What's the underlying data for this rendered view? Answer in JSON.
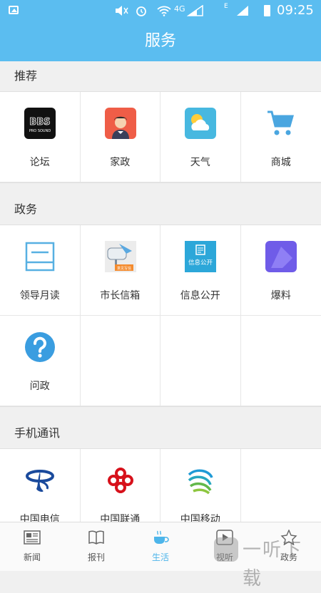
{
  "status_bar": {
    "time": "09:25",
    "network": "4G",
    "network2": "E"
  },
  "header": {
    "title": "服务"
  },
  "sections": [
    {
      "title": "推荐",
      "items": [
        {
          "label": "论坛",
          "icon": "bbs-icon"
        },
        {
          "label": "家政",
          "icon": "housekeeping-icon"
        },
        {
          "label": "天气",
          "icon": "weather-icon"
        },
        {
          "label": "商城",
          "icon": "shopping-cart-icon"
        }
      ]
    },
    {
      "title": "政务",
      "items": [
        {
          "label": "领导月读",
          "icon": "document-icon"
        },
        {
          "label": "市长信箱",
          "icon": "mailbox-icon"
        },
        {
          "label": "信息公开",
          "icon": "info-public-icon"
        },
        {
          "label": "爆料",
          "icon": "tipoff-icon"
        },
        {
          "label": "问政",
          "icon": "question-icon"
        }
      ]
    },
    {
      "title": "手机通讯",
      "items": [
        {
          "label": "中国电信",
          "icon": "china-telecom-icon"
        },
        {
          "label": "中国联通",
          "icon": "china-unicom-icon"
        },
        {
          "label": "中国移动",
          "icon": "china-mobile-icon"
        }
      ]
    }
  ],
  "icon_texts": {
    "bbs": "BBS",
    "bbs_sub": "PRO SOUND",
    "info": "信息公开",
    "mailbox_tag": "意见写信"
  },
  "tabs": [
    {
      "label": "新闻",
      "icon": "newspaper-icon",
      "active": false
    },
    {
      "label": "报刊",
      "icon": "book-icon",
      "active": false
    },
    {
      "label": "生活",
      "icon": "coffee-icon",
      "active": true
    },
    {
      "label": "视听",
      "icon": "play-icon",
      "active": false
    },
    {
      "label": "政务",
      "icon": "star-icon",
      "active": false
    }
  ],
  "watermark": {
    "text": "一听下载"
  },
  "colors": {
    "accent": "#5bbdf0",
    "active_tab": "#4db5ea"
  }
}
